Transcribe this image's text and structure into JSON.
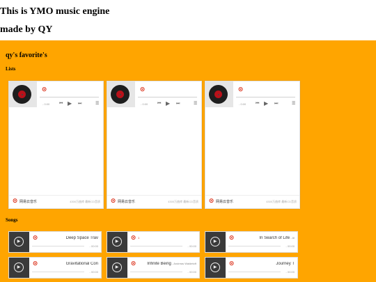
{
  "header": {
    "title": "This is YMO music engine",
    "subtitle": "made by QY"
  },
  "section": {
    "title": "qy's favorite's",
    "lists_label": "Lists",
    "songs_label": "Songs"
  },
  "lists": [
    {
      "time": "- 0:00",
      "brand": "网易云音乐",
      "meta": "4300万曲库 最新CD音质"
    },
    {
      "time": "- 0:00",
      "brand": "网易云音乐",
      "meta": "4300万曲库 最新CD音质"
    },
    {
      "time": "- 0:00",
      "brand": "网易云音乐",
      "meta": "4300万曲库 最新CD音质"
    }
  ],
  "songs": [
    {
      "title": "Deep Space Trav",
      "artist": "",
      "time": "- 00:00"
    },
    {
      "title": "1",
      "artist": "",
      "time": "- 00:00"
    },
    {
      "title": "In Search of Life",
      "artist": " - Al",
      "time": "- 00:00"
    },
    {
      "title": "Gravitational Con",
      "artist": "",
      "time": "- 00:00"
    },
    {
      "title": "Infinite Being",
      "artist": " - Andreas Waldetoft",
      "time": "- 00:00"
    },
    {
      "title": "Journey T",
      "artist": "",
      "time": "- 00:00"
    }
  ],
  "icons": {
    "netease_logo": "netease-logo-icon",
    "play": "play-icon",
    "prev": "prev-icon",
    "next": "next-icon",
    "playlist": "playlist-icon"
  },
  "colors": {
    "background": "#ffa500",
    "brand_red": "#d81e06",
    "card_bg": "#ffffff"
  }
}
